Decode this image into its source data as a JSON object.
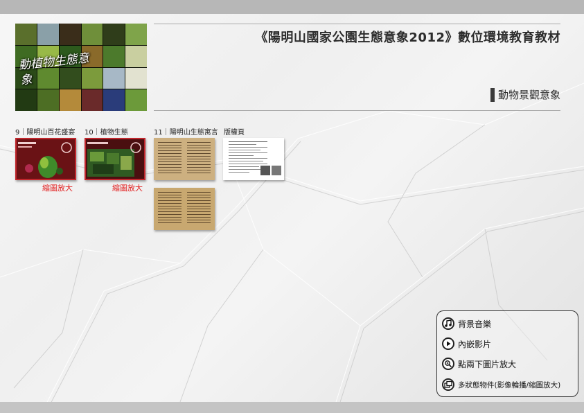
{
  "header": {
    "title": "《陽明山國家公園生態意象2012》數位環境教育教材",
    "section": "動物景觀意象"
  },
  "cover": {
    "title": "動植物生態意象"
  },
  "items": [
    {
      "label": "9｜陽明山百花盛宴",
      "zoom": "縮圖放大"
    },
    {
      "label": "10｜植物生態",
      "zoom": "縮圖放大"
    },
    {
      "label": "11｜陽明山生態寓言"
    },
    {
      "label": "版權頁"
    }
  ],
  "legend": {
    "items": [
      {
        "icon": "music-note-icon",
        "label": "背景音樂"
      },
      {
        "icon": "play-icon",
        "label": "內嵌影片"
      },
      {
        "icon": "magnifier-icon",
        "label": "點兩下圖片放大"
      },
      {
        "icon": "multi-window-icon",
        "label": "多狀態物件(影像輪播/縮圖放大)"
      }
    ]
  },
  "colors": {
    "accent_red": "#e21b1b",
    "thumb_border": "#c0262c",
    "top_bar": "#b7b7b7"
  }
}
